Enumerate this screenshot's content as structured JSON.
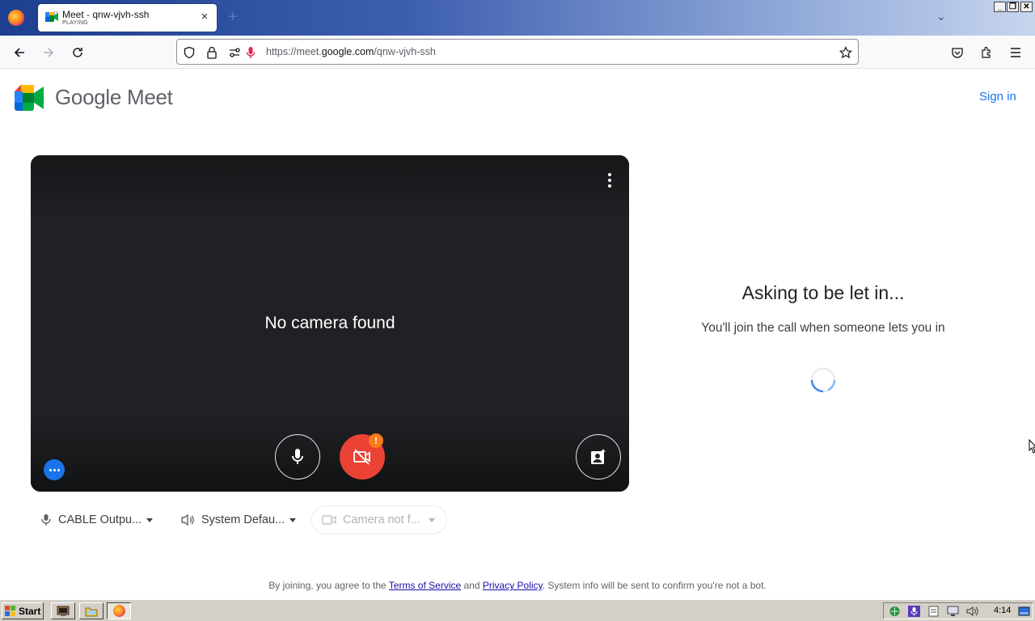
{
  "browser": {
    "tab": {
      "title": "Meet - qnw-vjvh-ssh",
      "subtitle": "PLAYING",
      "close": "×"
    },
    "new_tab": "+",
    "window_buttons": {
      "minimize": "_",
      "restore": "❐",
      "close": "✕"
    },
    "url": {
      "prefix": "https://meet.",
      "domain": "google.com",
      "path": "/qnw-vjvh-ssh"
    }
  },
  "header": {
    "logo_text": "Google Meet",
    "sign_in": "Sign in"
  },
  "preview": {
    "message": "No camera found",
    "warning_badge": "!"
  },
  "devices": {
    "microphone": "CABLE Outpu...",
    "speaker": "System Defau...",
    "camera": "Camera not f..."
  },
  "status": {
    "title": "Asking to be let in...",
    "subtitle": "You'll join the call when someone lets you in"
  },
  "footer": {
    "pre": "By joining, you agree to the ",
    "terms": "Terms of Service",
    "and": " and ",
    "privacy": "Privacy Policy",
    "post": ". System info will be sent to confirm you're not a bot."
  },
  "taskbar": {
    "start": "Start",
    "clock": "4:14"
  },
  "colors": {
    "accent": "#1a73e8",
    "danger": "#ea4335",
    "warning": "#fa7b17",
    "video_bg": "#202124"
  }
}
